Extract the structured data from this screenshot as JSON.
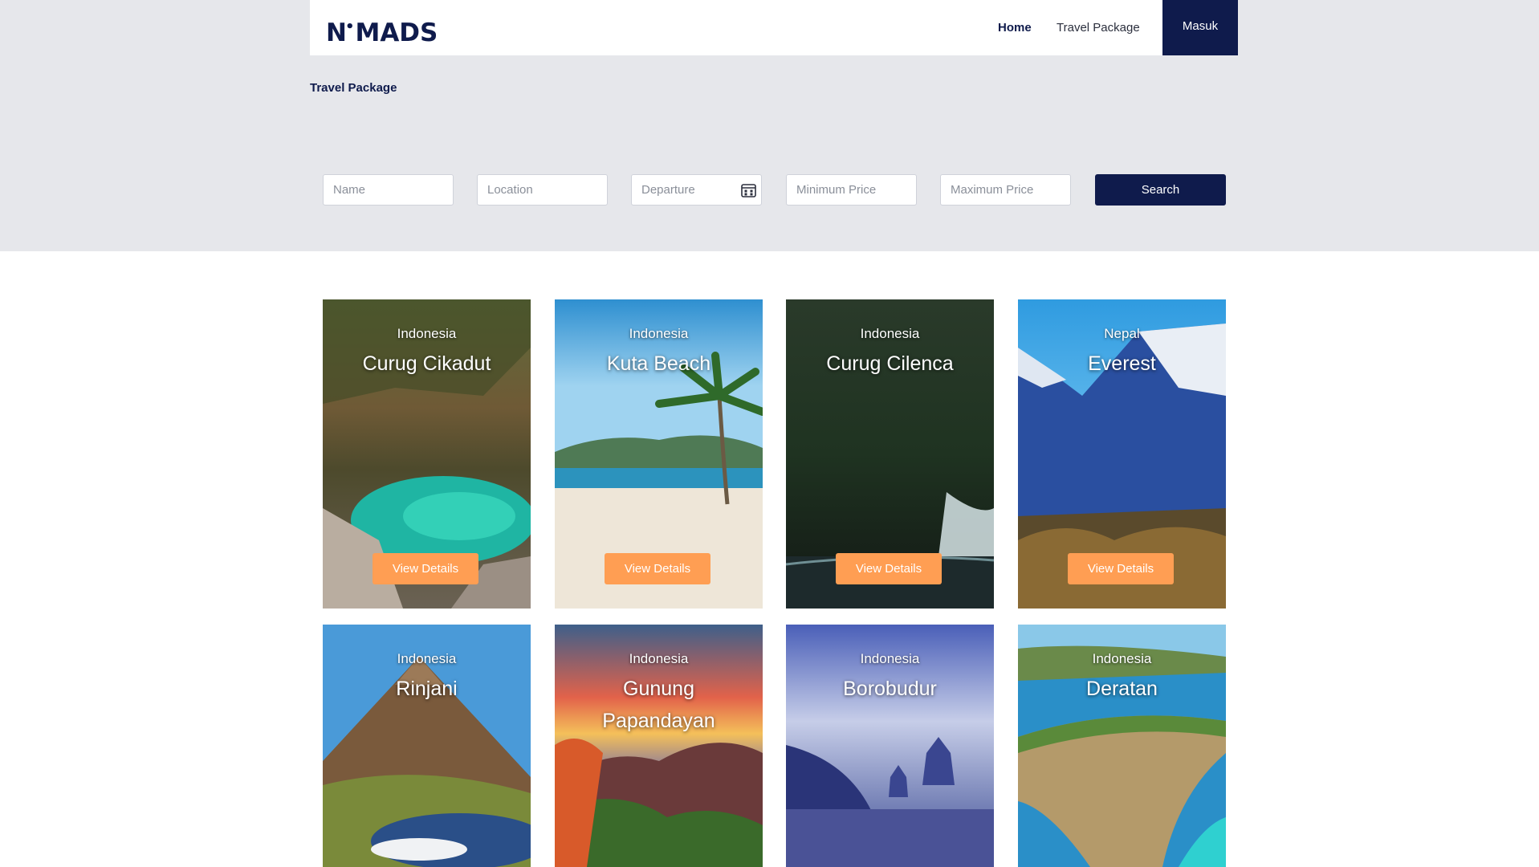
{
  "brand": {
    "logo": "N MADS"
  },
  "nav": {
    "home": "Home",
    "travel_package": "Travel Package",
    "login": "Masuk"
  },
  "breadcrumb": "Travel Package",
  "filters": {
    "name_placeholder": "Name",
    "location_placeholder": "Location",
    "departure_placeholder": "Departure",
    "min_price_placeholder": "Minimum Price",
    "max_price_placeholder": "Maximum Price",
    "search_label": "Search",
    "calendar_icon": "calendar-icon"
  },
  "packages": [
    {
      "country": "Indonesia",
      "name": "Curug Cikadut",
      "button": "View Details"
    },
    {
      "country": "Indonesia",
      "name": "Kuta Beach",
      "button": "View Details"
    },
    {
      "country": "Indonesia",
      "name": "Curug Cilenca",
      "button": "View Details"
    },
    {
      "country": "Nepal",
      "name": "Everest",
      "button": "View Details"
    },
    {
      "country": "Indonesia",
      "name": "Rinjani"
    },
    {
      "country": "Indonesia",
      "name": "Gunung Papandayan"
    },
    {
      "country": "Indonesia",
      "name": "Borobudur"
    },
    {
      "country": "Indonesia",
      "name": "Deratan"
    }
  ],
  "colors": {
    "navy": "#0f1b4c",
    "accent": "#ff9e53",
    "hero_bg": "#e6e7eb"
  }
}
